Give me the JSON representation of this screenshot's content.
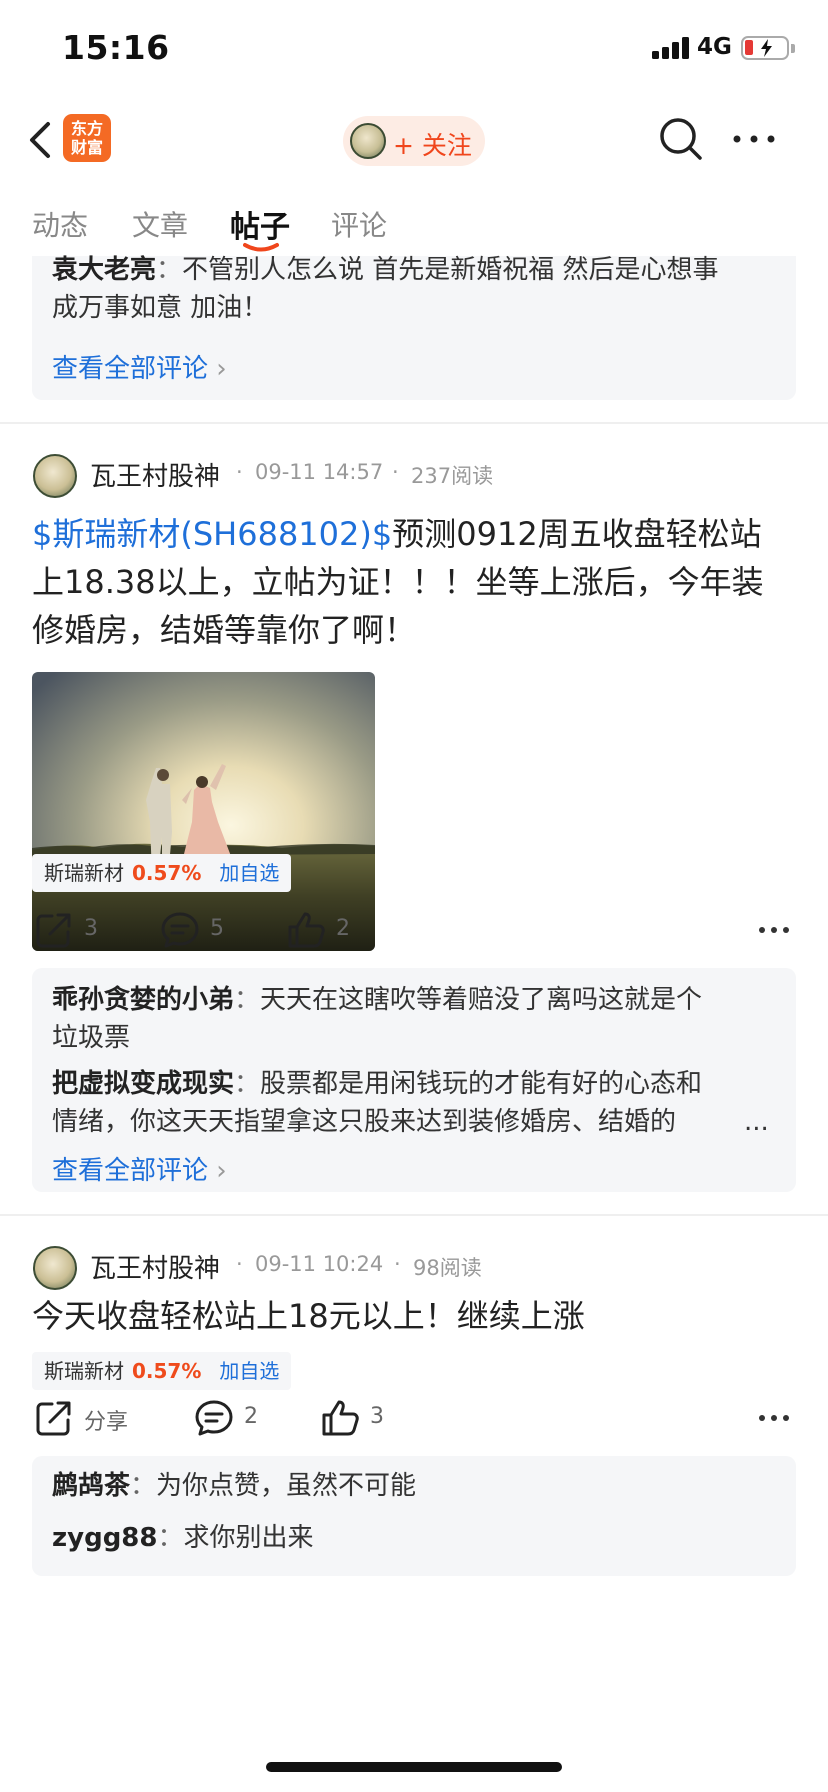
{
  "status_bar": {
    "time": "15:16",
    "network": "4G"
  },
  "nav": {
    "logo_text": "东方财富",
    "follow_label": "+ 关注"
  },
  "tabs": [
    {
      "label": "动态",
      "active": false
    },
    {
      "label": "文章",
      "active": false
    },
    {
      "label": "帖子",
      "active": true
    },
    {
      "label": "评论",
      "active": false
    }
  ],
  "top_comments": {
    "lines": [
      {
        "user": "袁大老亮",
        "sep": "：",
        "text": "不管别人怎么说 首先是新婚祝福 然后是心想事"
      },
      {
        "user": "",
        "sep": "",
        "text": "成万事如意 加油！"
      }
    ],
    "view_all": "查看全部评论",
    "view_all_chevron": "›"
  },
  "post1": {
    "author": "瓦王村股神",
    "time": "09-11 14:57",
    "reads": "237阅读",
    "dot": "·",
    "stock_link": "$斯瑞新材(SH688102)$",
    "lines": [
      "预测0912周五收盘轻松站",
      "上18.38以上，立帖为证！！！坐等上涨后，今年装",
      "修婚房，结婚等靠你了啊！"
    ],
    "stock_tag": {
      "name": "斯瑞新材",
      "pct": "0.57%",
      "add": "加自选"
    },
    "actions": {
      "share": "3",
      "comment": "5",
      "like": "2"
    },
    "comments": [
      {
        "user": "乖孙贪婪的小弟",
        "sep": "：",
        "line1": "天天在这瞎吹等着赔没了离吗这就是个",
        "line2": "垃圾票"
      },
      {
        "user": "把虚拟变成现实",
        "sep": "：",
        "line1": "股票都是用闲钱玩的才能有好的心态和",
        "line2": "情绪，你这天天指望拿这只股来达到装修婚房、结婚的",
        "ellipsis": "..."
      }
    ],
    "view_all": "查看全部评论",
    "view_all_chevron": "›"
  },
  "post2": {
    "author": "瓦王村股神",
    "time": "09-11 10:24",
    "reads": "98阅读",
    "dot": "·",
    "text": "今天收盘轻松站上18元以上！继续上涨",
    "stock_tag": {
      "name": "斯瑞新材",
      "pct": "0.57%",
      "add": "加自选"
    },
    "actions": {
      "share": "分享",
      "comment": "2",
      "like": "3"
    },
    "comments": [
      {
        "user": "鹧鸪茶",
        "sep": "：",
        "text": "为你点赞，虽然不可能"
      },
      {
        "user": "zygg88",
        "sep": "：",
        "text": "求你别出来"
      }
    ]
  },
  "colors": {
    "accent": "#f0461c",
    "link": "#1e6fd9",
    "logo": "#f46a24",
    "up": "#ef4b1c"
  }
}
